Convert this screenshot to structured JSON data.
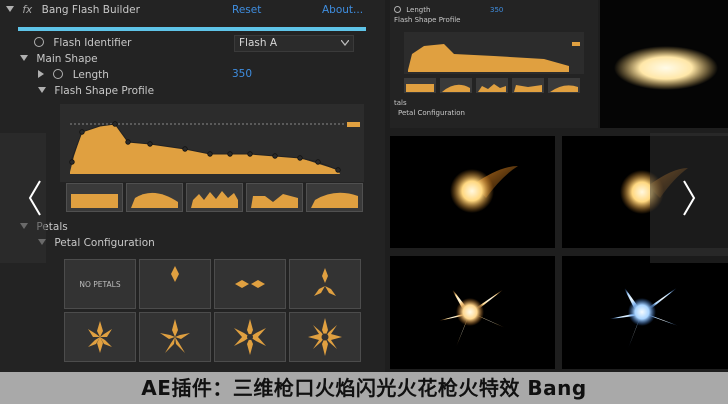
{
  "panel": {
    "fx_label": "fx",
    "title": "Bang Flash Builder",
    "reset_label": "Reset",
    "about_label": "About...",
    "flash_identifier_label": "Flash Identifier",
    "flash_identifier_value": "Flash A",
    "main_shape_label": "Main Shape",
    "length_label": "Length",
    "length_value": "350",
    "flash_shape_profile_label": "Flash Shape Profile",
    "petals_label": "Petals",
    "petal_configuration_label": "Petal Configuration",
    "no_petals_label": "NO PETALS"
  },
  "mini_panel": {
    "length_label": "Length",
    "length_value": "350",
    "flash_shape_profile_label": "Flash Shape Profile",
    "petals_label": "tals",
    "petal_configuration_label": "Petal Configuration"
  },
  "caption": "AE插件：三维枪口火焰闪光火花枪火特效 Bang",
  "icons": {
    "prev": "chevron-left-icon",
    "next": "chevron-right-icon",
    "stopwatch": "stopwatch-icon"
  },
  "colors": {
    "accent_orange": "#e0a040",
    "accent_blue": "#3f8ee0",
    "cyan_bar": "#5fc4e8"
  }
}
